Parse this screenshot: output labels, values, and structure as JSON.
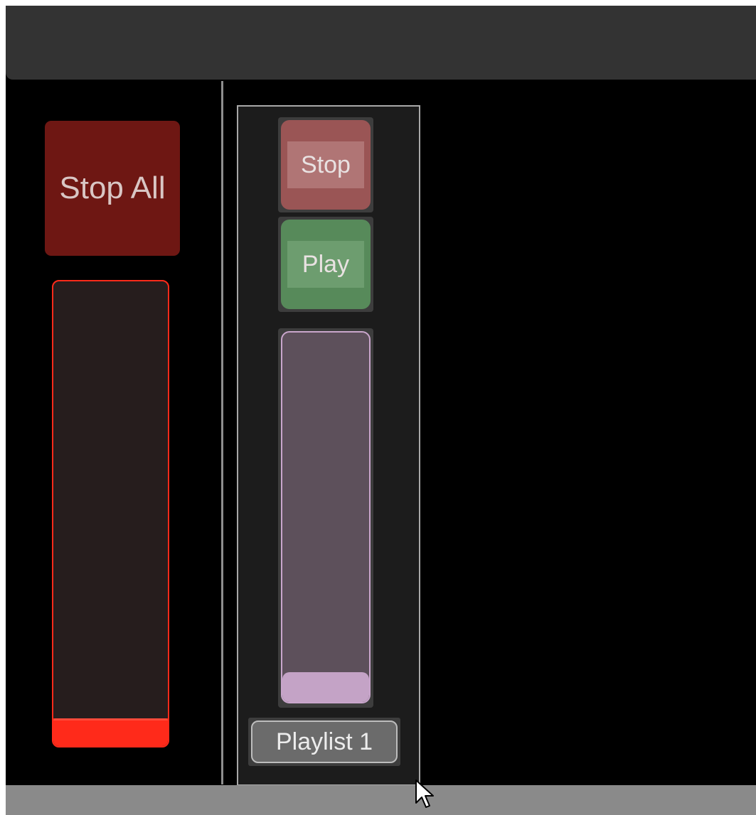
{
  "master": {
    "stop_all_label": "Stop All",
    "fader_level": 0.06,
    "fader_color": "#ff2a1a"
  },
  "playlist": {
    "stop_label": "Stop",
    "play_label": "Play",
    "name": "Playlist 1",
    "fader_level": 0.08,
    "fader_color": "#c4a3c6"
  },
  "icons": {
    "cursor": "mouse-pointer-icon"
  }
}
